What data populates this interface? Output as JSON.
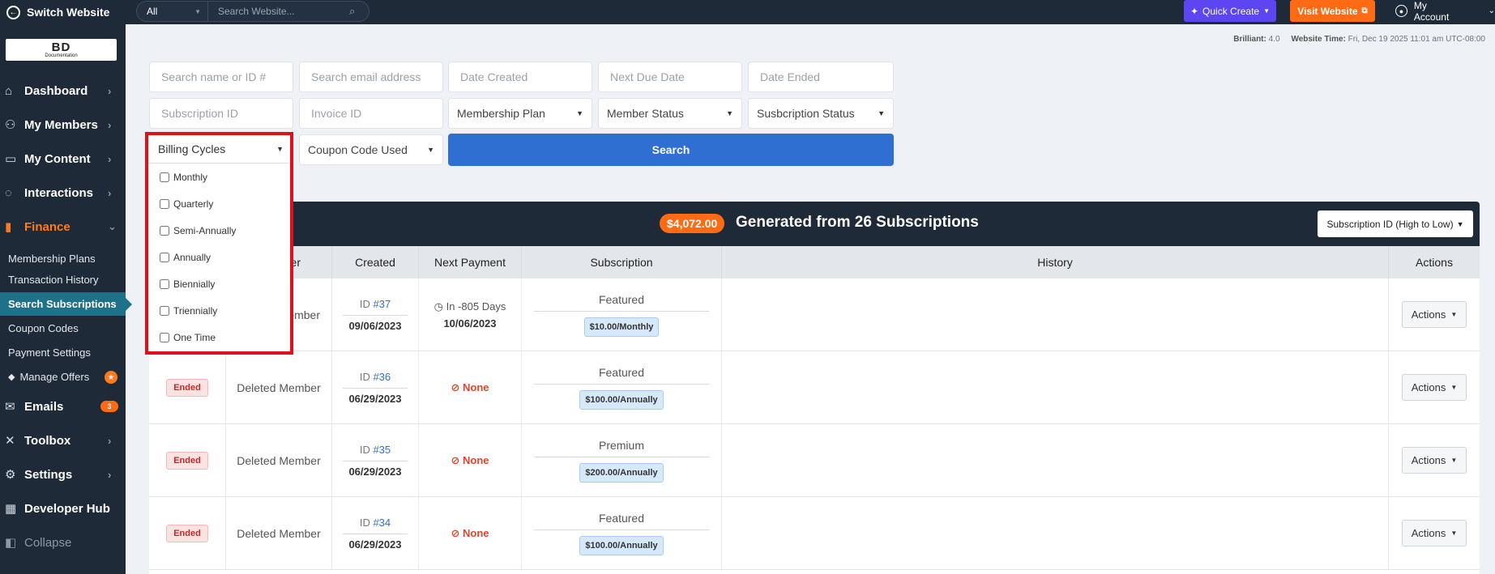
{
  "topbar": {
    "switch_label": "Switch Website",
    "search_scope": "All",
    "search_placeholder": "Search Website...",
    "quick_create": "Quick Create",
    "visit_website": "Visit Website",
    "account": "My Account"
  },
  "sidebar": {
    "logo_text": "BD",
    "logo_sub": "Documentation",
    "items": {
      "dashboard": "Dashboard",
      "members": "My Members",
      "content": "My Content",
      "interactions": "Interactions",
      "finance": "Finance",
      "emails": "Emails",
      "toolbox": "Toolbox",
      "settings": "Settings",
      "developer": "Developer Hub",
      "collapse": "Collapse"
    },
    "finance_sub": {
      "membership_plans": "Membership Plans",
      "transaction_history": "Transaction History",
      "search_subscriptions": "Search Subscriptions",
      "coupon_codes": "Coupon Codes",
      "payment_settings": "Payment Settings",
      "manage_offers": "Manage Offers"
    },
    "emails_badge": "3"
  },
  "info": {
    "brilliant_label": "Brilliant:",
    "brilliant_value": "4.0",
    "time_label": "Website Time:",
    "time_value": "Fri, Dec 19 2025 11:01 am UTC-08:00"
  },
  "filters": {
    "name_placeholder": "Search name or ID #",
    "email_placeholder": "Search email address",
    "date_created": "Date Created",
    "next_due": "Next Due Date",
    "date_ended": "Date Ended",
    "subscription_id": "Subscription ID",
    "invoice_id": "Invoice ID",
    "membership_plan": "Membership Plan",
    "member_status": "Member Status",
    "subscription_status": "Susbcription Status",
    "billing_cycles": "Billing Cycles",
    "coupon_code": "Coupon Code Used",
    "search_button": "Search"
  },
  "billing_dropdown": {
    "options": [
      "Monthly",
      "Quarterly",
      "Semi-Annually",
      "Annually",
      "Biennially",
      "Triennially",
      "One Time"
    ]
  },
  "summary": {
    "amount": "$4,072.00",
    "generated": "Generated from 26 Subscriptions",
    "sort": "Subscription ID (High to Low)"
  },
  "table": {
    "headers": {
      "member": "er",
      "created": "Created",
      "next_payment": "Next Payment",
      "subscription": "Subscription",
      "history": "History",
      "actions": "Actions"
    },
    "rows": [
      {
        "status": "",
        "member": "ember",
        "id_prefix": "ID",
        "id": "#37",
        "created": "09/06/2023",
        "next_days": "In -805 Days",
        "next_date": "10/06/2023",
        "plan": "Featured",
        "price": "$10.00/Monthly",
        "action": "Actions"
      },
      {
        "status": "Ended",
        "member": "Deleted Member",
        "id_prefix": "ID",
        "id": "#36",
        "created": "06/29/2023",
        "next": "None",
        "plan": "Featured",
        "price": "$100.00/Annually",
        "action": "Actions"
      },
      {
        "status": "Ended",
        "member": "Deleted Member",
        "id_prefix": "ID",
        "id": "#35",
        "created": "06/29/2023",
        "next": "None",
        "plan": "Premium",
        "price": "$200.00/Annually",
        "action": "Actions"
      },
      {
        "status": "Ended",
        "member": "Deleted Member",
        "id_prefix": "ID",
        "id": "#34",
        "created": "06/29/2023",
        "next": "None",
        "plan": "Featured",
        "price": "$100.00/Annually",
        "action": "Actions"
      }
    ]
  }
}
